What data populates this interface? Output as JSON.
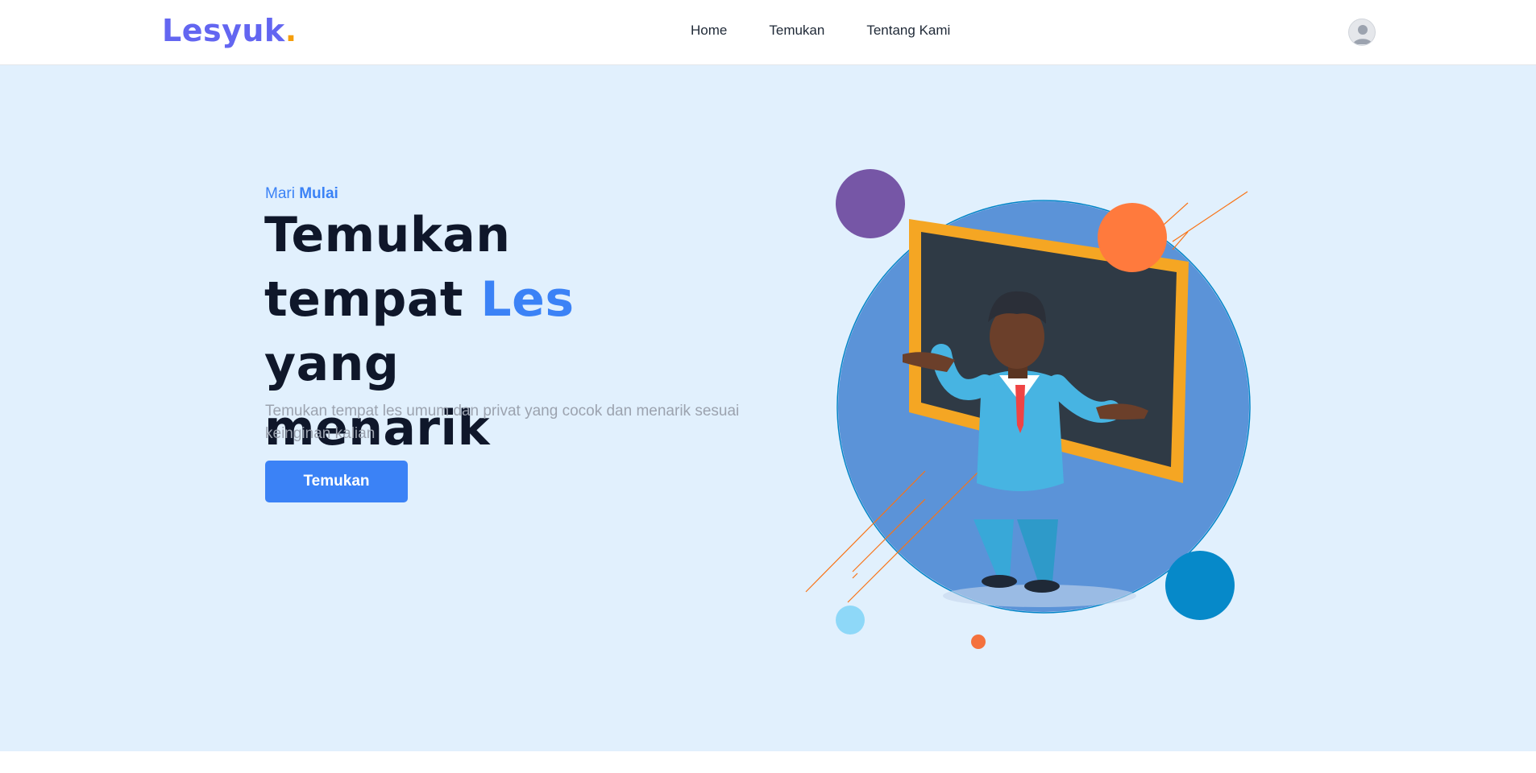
{
  "brand": {
    "name": "Lesyuk",
    "dot": "."
  },
  "nav": {
    "links": [
      "Home",
      "Temukan",
      "Tentang Kami"
    ]
  },
  "hero": {
    "eyebrow_plain": "Mari",
    "eyebrow_bold": "Mulai",
    "headline_line1": "Temukan",
    "headline_line2_start": "tempat ",
    "headline_accent": "Les",
    "headline_line2_end": " yang",
    "headline_line3": "menarik",
    "subtext": "Temukan tempat les umum dan privat yang cocok dan menarik sesuai keinginan kalian",
    "cta_label": "Temukan"
  },
  "colors": {
    "brand": "#6366f1",
    "brand_dot": "#f59e0b",
    "accent": "#3b82f6",
    "hero_bg": "#e1f0fd",
    "headline": "#0f172a"
  }
}
